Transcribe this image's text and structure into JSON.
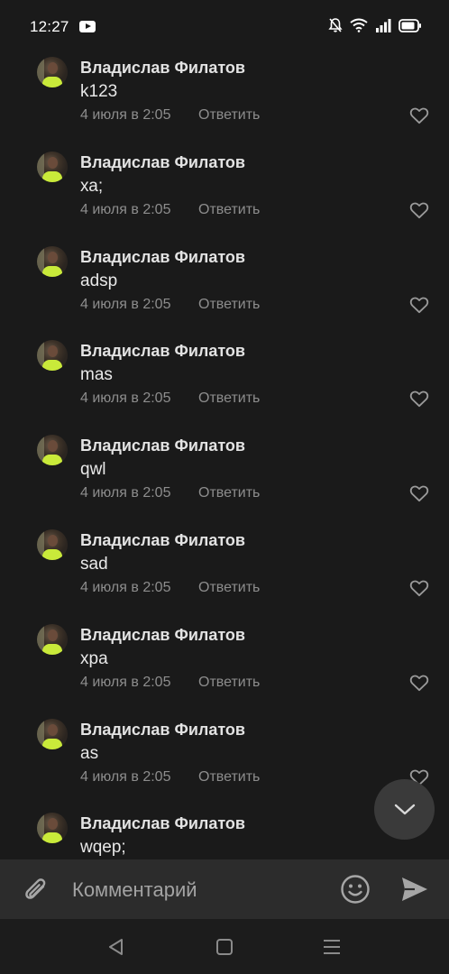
{
  "status_bar": {
    "time": "12:27",
    "icons": [
      "youtube-icon",
      "mute-bell-icon",
      "wifi-icon",
      "signal-icon",
      "battery-icon"
    ]
  },
  "comments": [
    {
      "author": "Владислав Филатов",
      "text": "k123",
      "date": "4 июля в 2:05",
      "reply_label": "Ответить"
    },
    {
      "author": "Владислав Филатов",
      "text": "ха;",
      "date": "4 июля в 2:05",
      "reply_label": "Ответить"
    },
    {
      "author": "Владислав Филатов",
      "text": "adsp",
      "date": "4 июля в 2:05",
      "reply_label": "Ответить"
    },
    {
      "author": "Владислав Филатов",
      "text": "mas",
      "date": "4 июля в 2:05",
      "reply_label": "Ответить"
    },
    {
      "author": "Владислав Филатов",
      "text": "qwl",
      "date": "4 июля в 2:05",
      "reply_label": "Ответить"
    },
    {
      "author": "Владислав Филатов",
      "text": "sad",
      "date": "4 июля в 2:05",
      "reply_label": "Ответить"
    },
    {
      "author": "Владислав Филатов",
      "text": "хра",
      "date": "4 июля в 2:05",
      "reply_label": "Ответить"
    },
    {
      "author": "Владислав Филатов",
      "text": "as",
      "date": "4 июля в 2:05",
      "reply_label": "Ответить"
    },
    {
      "author": "Владислав Филатов",
      "text": "wqep;",
      "date": "",
      "reply_label": ""
    }
  ],
  "composer": {
    "placeholder": "Комментарий"
  },
  "colors": {
    "background": "#1a1a1a",
    "composer_bg": "#2c2c2c",
    "secondary_text": "#8d8d8d",
    "fab_bg": "#3a3a3a"
  }
}
